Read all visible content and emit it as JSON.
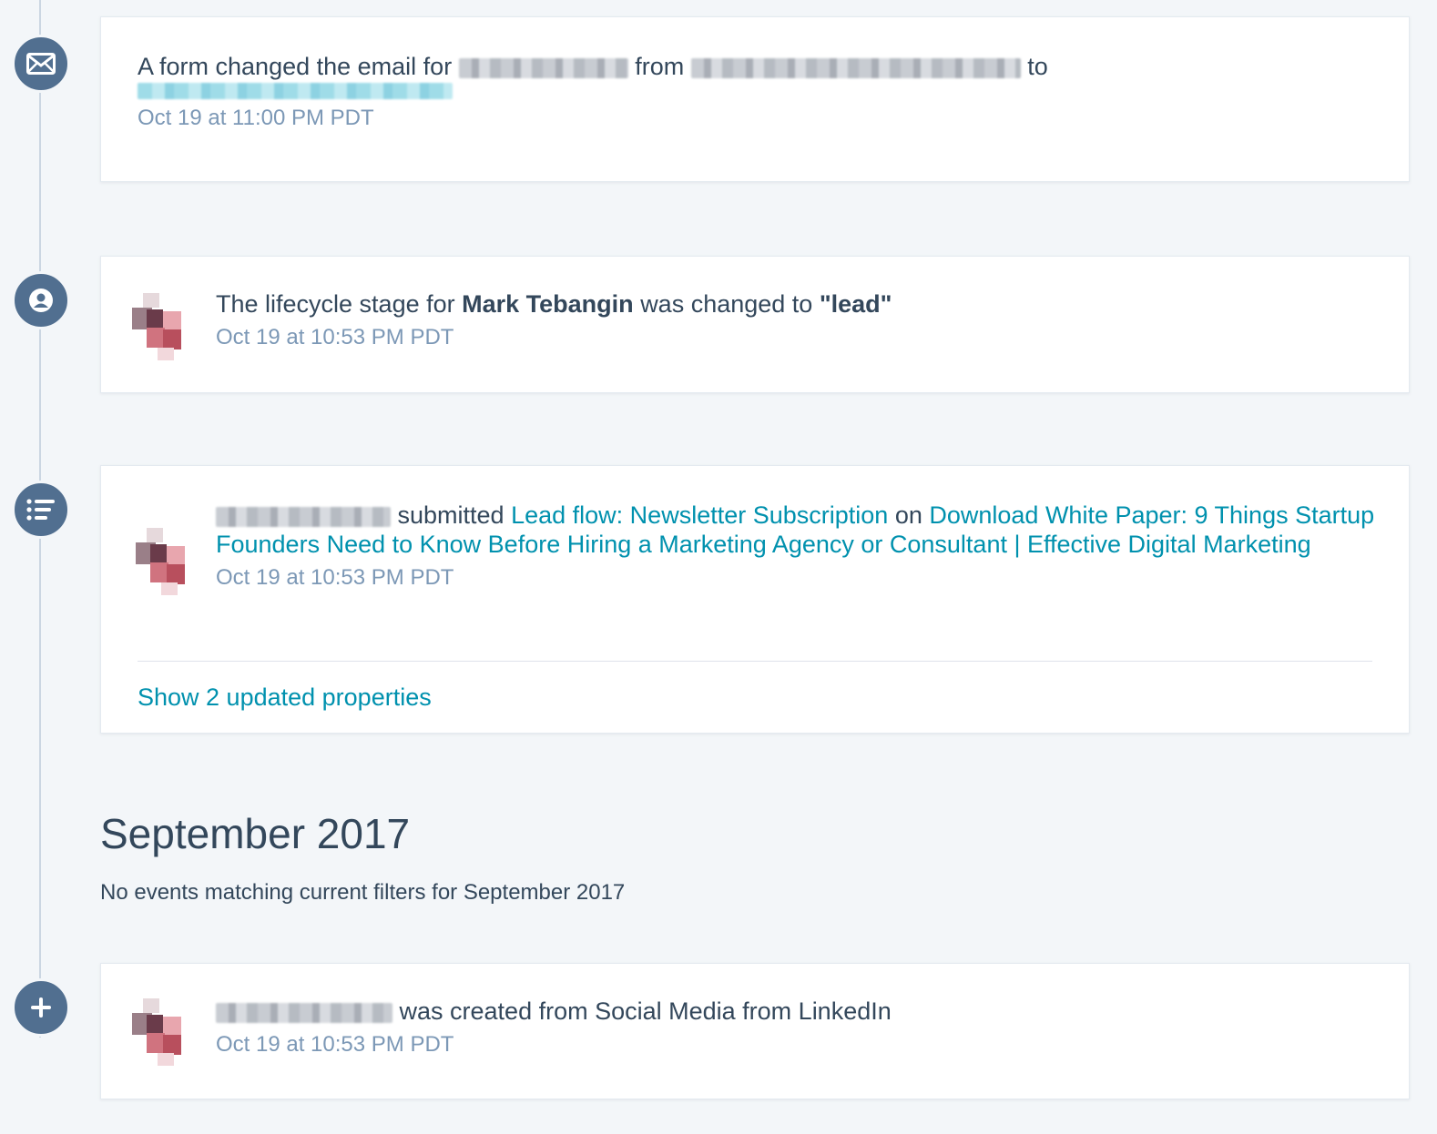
{
  "events": [
    {
      "prefix": "A form changed the email for",
      "mid": "from",
      "suffix": "to",
      "timestamp": "Oct 19 at 11:00 PM PDT",
      "icon": "envelope-icon"
    },
    {
      "prefix": "The lifecycle stage for",
      "contact_name": "Mark Tebangin",
      "mid": "was changed to",
      "stage": "\"lead\"",
      "timestamp": "Oct 19 at 10:53 PM PDT",
      "icon": "person-icon"
    },
    {
      "verb": "submitted",
      "form_link": "Lead flow: Newsletter Subscription",
      "on": "on",
      "page_link": "Download White Paper: 9 Things Startup Founders Need to Know Before Hiring a Marketing Agency or Consultant | Effective Digital Marketing",
      "timestamp": "Oct 19 at 10:53 PM PDT",
      "show_properties": "Show 2 updated properties",
      "icon": "form-list-icon"
    },
    {
      "text": "was created from Social Media from LinkedIn",
      "timestamp": "Oct 19 at 10:53 PM PDT",
      "icon": "plus-icon"
    }
  ],
  "month_section": {
    "title": "September 2017",
    "note": "No events matching current filters for September 2017"
  },
  "colors": {
    "node": "#516f90",
    "link": "#0091ae",
    "timestamp": "#7c98b6",
    "text": "#33475b",
    "background": "#f3f6f9"
  }
}
